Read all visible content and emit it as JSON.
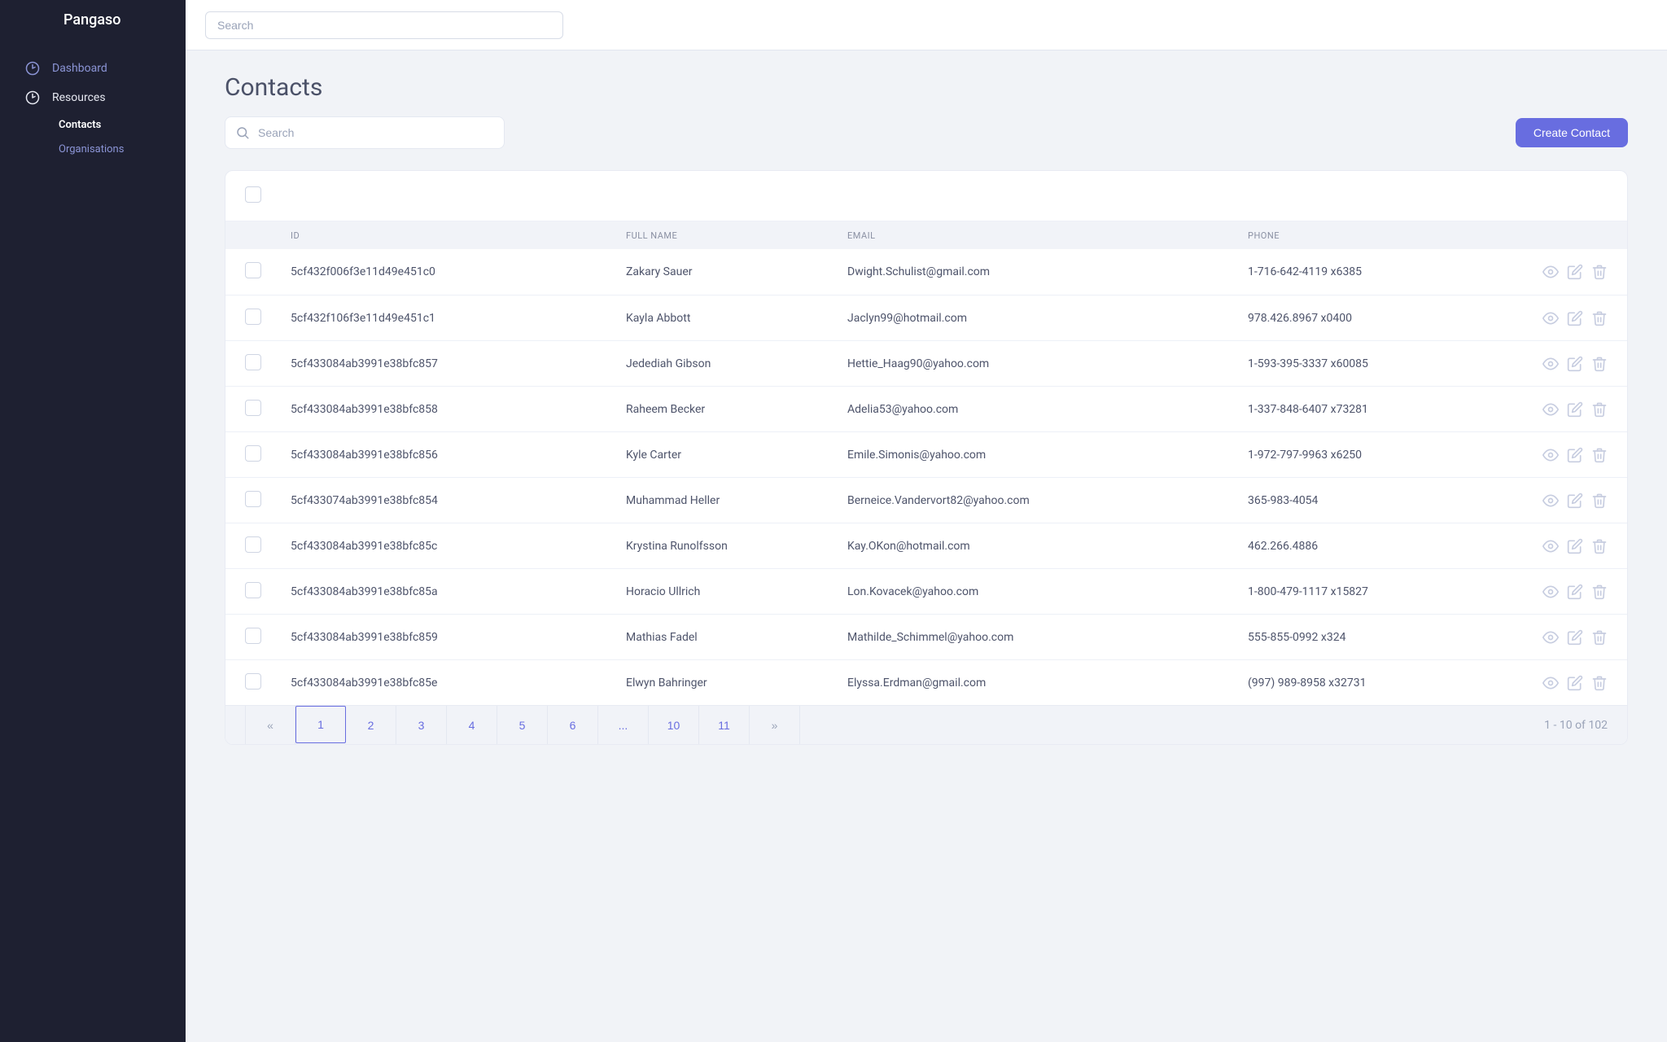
{
  "brand": "Pangaso",
  "topbar": {
    "search_placeholder": "Search"
  },
  "sidebar": {
    "dashboard_label": "Dashboard",
    "resources_label": "Resources",
    "resources": [
      {
        "label": "Contacts",
        "active": true
      },
      {
        "label": "Organisations",
        "active": false
      }
    ]
  },
  "page": {
    "title": "Contacts",
    "table_search_placeholder": "Search",
    "create_label": "Create Contact"
  },
  "table": {
    "columns": {
      "id": "ID",
      "name": "FULL NAME",
      "email": "EMAIL",
      "phone": "PHONE"
    },
    "rows": [
      {
        "id": "5cf432f006f3e11d49e451c0",
        "name": "Zakary Sauer",
        "email": "Dwight.Schulist@gmail.com",
        "phone": "1-716-642-4119 x6385"
      },
      {
        "id": "5cf432f106f3e11d49e451c1",
        "name": "Kayla Abbott",
        "email": "Jaclyn99@hotmail.com",
        "phone": "978.426.8967 x0400"
      },
      {
        "id": "5cf433084ab3991e38bfc857",
        "name": "Jedediah Gibson",
        "email": "Hettie_Haag90@yahoo.com",
        "phone": "1-593-395-3337 x60085"
      },
      {
        "id": "5cf433084ab3991e38bfc858",
        "name": "Raheem Becker",
        "email": "Adelia53@yahoo.com",
        "phone": "1-337-848-6407 x73281"
      },
      {
        "id": "5cf433084ab3991e38bfc856",
        "name": "Kyle Carter",
        "email": "Emile.Simonis@yahoo.com",
        "phone": "1-972-797-9963 x6250"
      },
      {
        "id": "5cf433074ab3991e38bfc854",
        "name": "Muhammad Heller",
        "email": "Berneice.Vandervort82@yahoo.com",
        "phone": "365-983-4054"
      },
      {
        "id": "5cf433084ab3991e38bfc85c",
        "name": "Krystina Runolfsson",
        "email": "Kay.OKon@hotmail.com",
        "phone": "462.266.4886"
      },
      {
        "id": "5cf433084ab3991e38bfc85a",
        "name": "Horacio Ullrich",
        "email": "Lon.Kovacek@yahoo.com",
        "phone": "1-800-479-1117 x15827"
      },
      {
        "id": "5cf433084ab3991e38bfc859",
        "name": "Mathias Fadel",
        "email": "Mathilde_Schimmel@yahoo.com",
        "phone": "555-855-0992 x324"
      },
      {
        "id": "5cf433084ab3991e38bfc85e",
        "name": "Elwyn Bahringer",
        "email": "Elyssa.Erdman@gmail.com",
        "phone": "(997) 989-8958 x32731"
      }
    ]
  },
  "pagination": {
    "prev": "«",
    "next": "»",
    "pages": [
      "1",
      "2",
      "3",
      "4",
      "5",
      "6",
      "...",
      "10",
      "11"
    ],
    "active_index": 0,
    "range": "1 - 10  of  102"
  }
}
